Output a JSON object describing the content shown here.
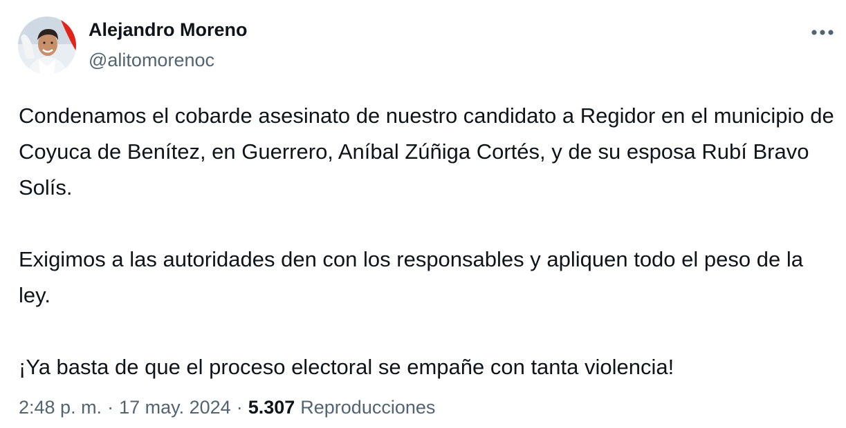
{
  "author": {
    "display_name": "Alejandro Moreno",
    "handle": "@alitomorenoc"
  },
  "icons": {
    "more": "more-horizontal-icon",
    "avatar": "profile-photo"
  },
  "tweet": {
    "paragraphs": [
      "Condenamos el cobarde asesinato de nuestro candidato a Regidor en el municipio de Coyuca de Benítez, en Guerrero, Aníbal Zúñiga Cortés, y de su esposa Rubí Bravo Solís.",
      "Exigimos a las autoridades den con los responsables y apliquen todo el peso de la ley.",
      "¡Ya basta de que el proceso electoral se empañe con tanta violencia!"
    ]
  },
  "meta": {
    "time": "2:48 p. m.",
    "separator": "·",
    "date": "17 may. 2024",
    "views_count": "5.307",
    "views_label": "Reproducciones"
  },
  "colors": {
    "text_primary": "#0f1419",
    "text_secondary": "#536471",
    "background": "#ffffff",
    "avatar_accent": "#e2231a"
  }
}
